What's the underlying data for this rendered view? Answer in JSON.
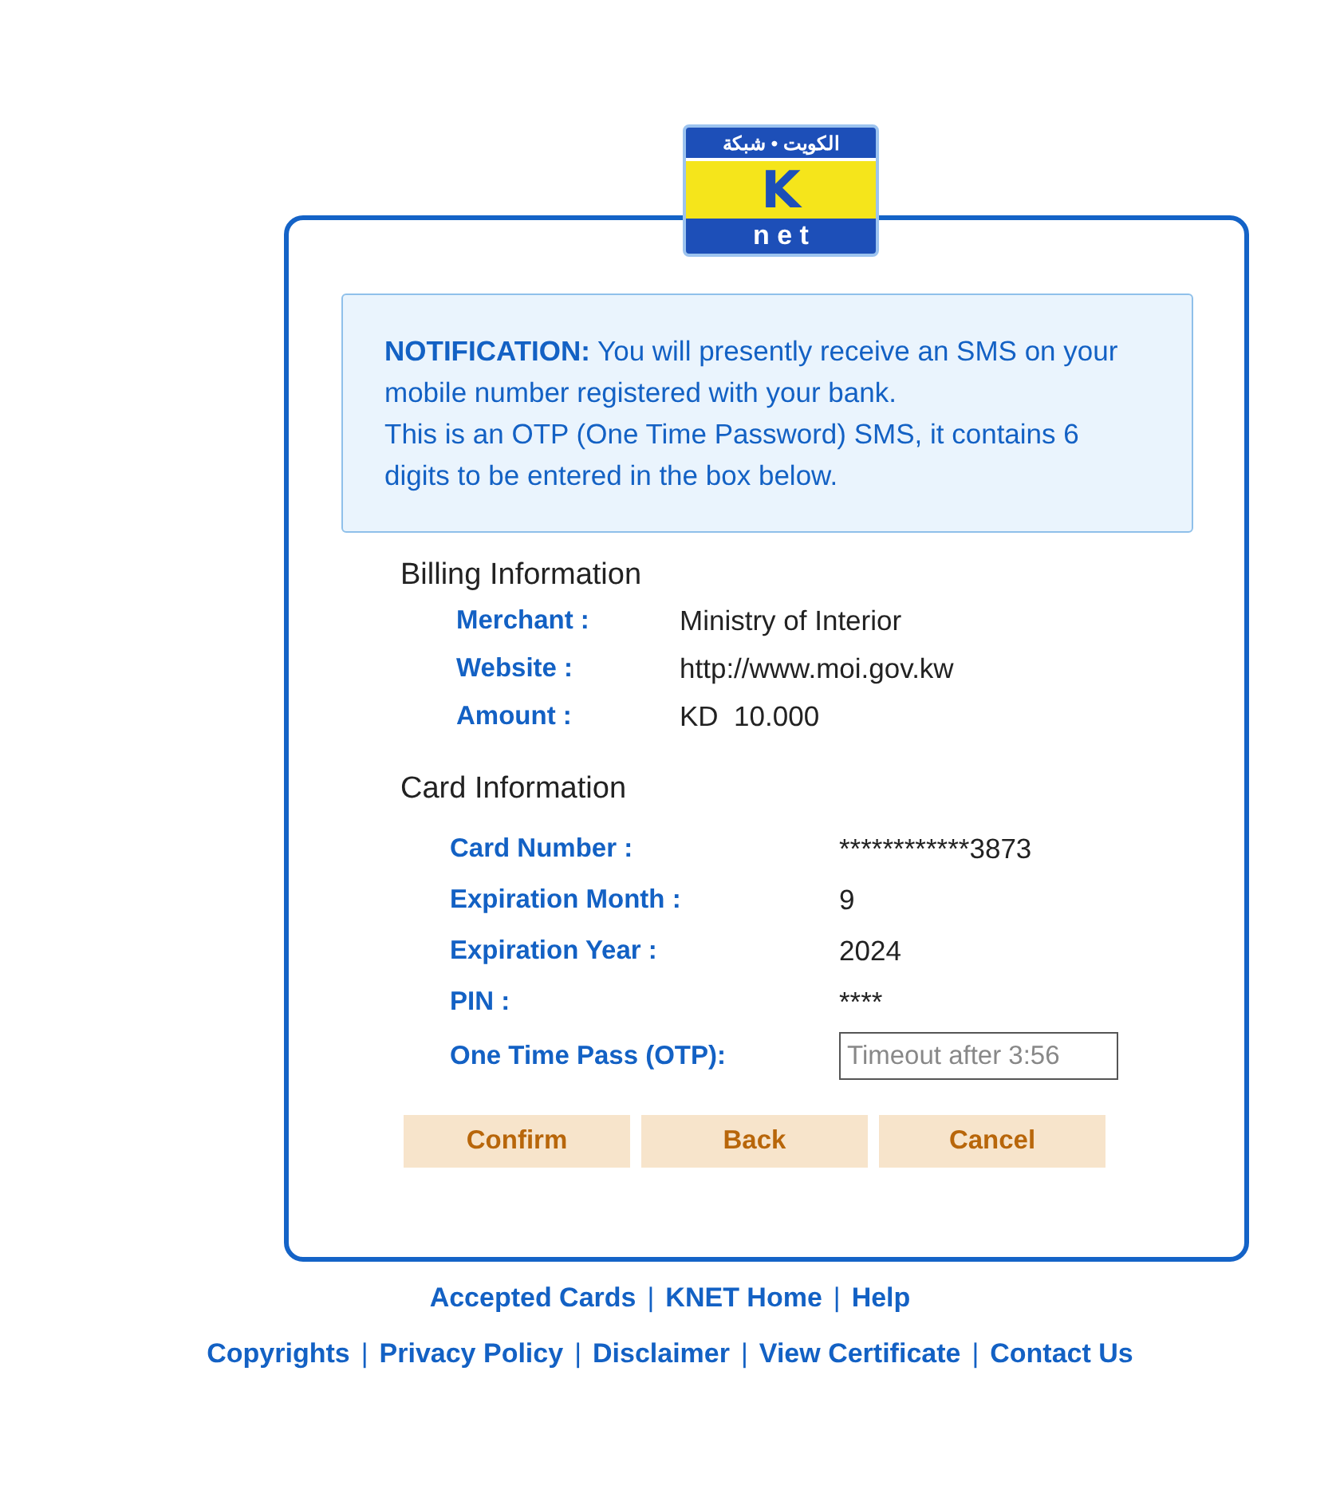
{
  "logo": {
    "arabic": "الكويت • شبكة",
    "letter": "K",
    "word": "n e t"
  },
  "notification": [
    "**NOTIFICATION:** You will presently receive an SMS on your mobile number registered with your bank.",
    "This is an OTP (One Time Password) SMS, it contains 6 digits to be entered in the box below."
  ],
  "billing": {
    "title": "Billing Information",
    "rows": [
      {
        "label": "Merchant :",
        "value": "Ministry of Interior"
      },
      {
        "label": "Website :",
        "value": "http://www.moi.gov.kw"
      },
      {
        "label": "Amount :",
        "value": "KD  10.000"
      }
    ]
  },
  "card": {
    "title": "Card Information",
    "rows": [
      {
        "kind": "text",
        "label": "Card Number :",
        "value": "************3873"
      },
      {
        "kind": "text",
        "label": "Expiration Month :",
        "value": "9"
      },
      {
        "kind": "text",
        "label": "Expiration Year :",
        "value": "2024"
      },
      {
        "kind": "text",
        "label": "PIN :",
        "value": "****"
      },
      {
        "kind": "input",
        "label": "One Time Pass (OTP):",
        "placeholder": "Timeout after 3:56"
      }
    ]
  },
  "buttons": [
    "Confirm",
    "Back",
    "Cancel"
  ],
  "footer": {
    "separator": "|",
    "main_links": [
      "Accepted Cards",
      "KNET Home",
      "Help"
    ],
    "legal_links": [
      "Copyrights",
      "Privacy Policy",
      "Disclaimer",
      "View Certificate",
      "Contact Us"
    ]
  }
}
